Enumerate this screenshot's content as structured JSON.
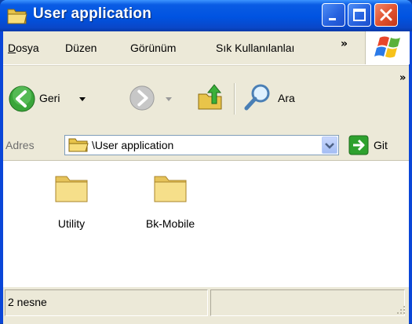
{
  "window": {
    "title": "User application",
    "icon": "folder-open-icon",
    "controls": [
      "minimize-icon",
      "maximize-icon",
      "close-icon"
    ]
  },
  "menu": {
    "items": [
      {
        "label": "Dosya"
      },
      {
        "label": "Düzen"
      },
      {
        "label": "Görünüm"
      },
      {
        "label": "Sık Kullanılanlaı"
      }
    ],
    "overflow": "»"
  },
  "toolbar": {
    "back_label": "Geri",
    "search_label": "Ara",
    "overflow": "»"
  },
  "address": {
    "label": "Adres",
    "value": "\\User application",
    "go_label": "Git"
  },
  "files": [
    {
      "name": "Utility",
      "icon": "folder-icon"
    },
    {
      "name": "Bk-Mobile",
      "icon": "folder-icon"
    }
  ],
  "status": {
    "text": "2 nesne"
  },
  "colors": {
    "titlebar": "#0053e1",
    "chrome": "#ece9d8",
    "close_button": "#e0502d",
    "go_arrow": "#2ea12e"
  }
}
